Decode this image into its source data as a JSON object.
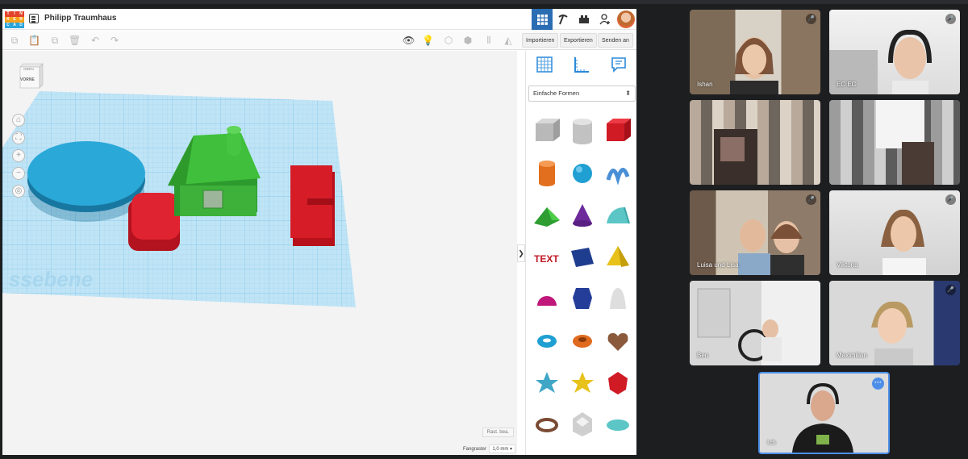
{
  "app": {
    "logo_letters": [
      "T",
      "I",
      "N",
      "K",
      "E",
      "R",
      "C",
      "A",
      "D"
    ],
    "logo_colors": [
      "#e4432b",
      "#e4432b",
      "#e4432b",
      "#f6a01b",
      "#f6a01b",
      "#f6a01b",
      "#2aa4dc",
      "#2aa4dc",
      "#2aa4dc"
    ],
    "doc_title": "Philipp Traumhaus",
    "header_icons": [
      "grid-view-icon",
      "pickaxe-icon",
      "blocks-icon",
      "add-user-icon",
      "user-avatar"
    ]
  },
  "toolbar": {
    "import_label": "Importieren",
    "export_label": "Exportieren",
    "send_label": "Senden an"
  },
  "workplane": {
    "viewcube_top": "OBEN",
    "viewcube_front": "VORNE",
    "plane_text": "ssebene",
    "edit_grid_label": "Rast. bea.",
    "snap_label": "Fangraster",
    "snap_value": "1,0 mm ▾",
    "collapse_glyph": "❯"
  },
  "panel": {
    "tabs": [
      "grid-tab-icon",
      "ruler-tab-icon",
      "notes-tab-icon"
    ],
    "category_selected": "Einfache Formen",
    "shapes": [
      "box-striped",
      "cylinder-striped",
      "box",
      "cylinder",
      "sphere",
      "scribble",
      "roof",
      "cone",
      "round-roof",
      "text",
      "prism",
      "pyramid",
      "half-sphere",
      "polygon",
      "paraboloid",
      "torus",
      "tube",
      "heart",
      "star",
      "star-3d",
      "icosahedron",
      "ring",
      "dodecahedron",
      "ellipsoid"
    ]
  },
  "participants": [
    {
      "name": "Ishan",
      "muted": true
    },
    {
      "name": "EC EC",
      "muted": true
    },
    {
      "name": "",
      "muted": false
    },
    {
      "name": "",
      "muted": false
    },
    {
      "name": "Luisa und Lisa",
      "muted": true
    },
    {
      "name": "Viktoria",
      "muted": true
    },
    {
      "name": "Ben",
      "muted": false
    },
    {
      "name": "Maximilian",
      "muted": true
    }
  ],
  "self_view": {
    "name": "Ich"
  }
}
